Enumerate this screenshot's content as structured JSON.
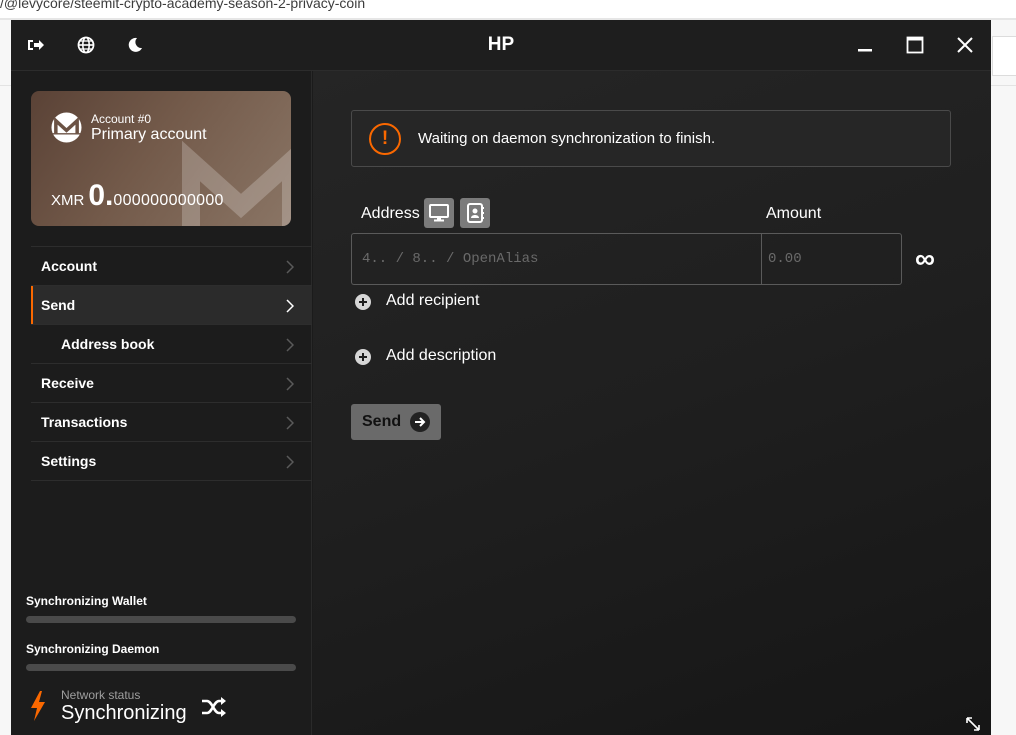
{
  "browser": {
    "url_fragment": "/@levycore/steemit-crypto-academy-season-2-privacy-coin"
  },
  "window": {
    "title": "HP",
    "toolbar_icons": [
      "sign-out-icon",
      "globe-icon",
      "moon-icon"
    ],
    "controls": [
      "minimize-icon",
      "maximize-icon",
      "close-icon"
    ]
  },
  "account_card": {
    "account_number": "Account #0",
    "account_name": "Primary account",
    "currency": "XMR",
    "balance_int": "0.",
    "balance_dec": "000000000000"
  },
  "sidebar": {
    "items": [
      {
        "label": "Account"
      },
      {
        "label": "Send"
      },
      {
        "label": "Address book"
      },
      {
        "label": "Receive"
      },
      {
        "label": "Transactions"
      },
      {
        "label": "Settings"
      }
    ],
    "active_index": 1,
    "sync_wallet": {
      "label": "Synchronizing Wallet",
      "progress": 0
    },
    "sync_daemon": {
      "label": "Synchronizing Daemon",
      "progress": 0
    },
    "network_status": {
      "caption": "Network status",
      "value": "Synchronizing"
    }
  },
  "main": {
    "warning_message": "Waiting on daemon synchronization to finish.",
    "address_label": "Address",
    "address_placeholder": "4.. / 8.. / OpenAlias",
    "amount_label": "Amount",
    "amount_placeholder": "0.00",
    "max_symbol": "∞",
    "add_recipient_label": "Add recipient",
    "add_description_label": "Add description",
    "send_label": "Send"
  },
  "colors": {
    "accent": "#fa6800",
    "window_bg": "#1b1b1b",
    "card_bg": "#735a4a",
    "send_button": "#6a6a6a"
  }
}
